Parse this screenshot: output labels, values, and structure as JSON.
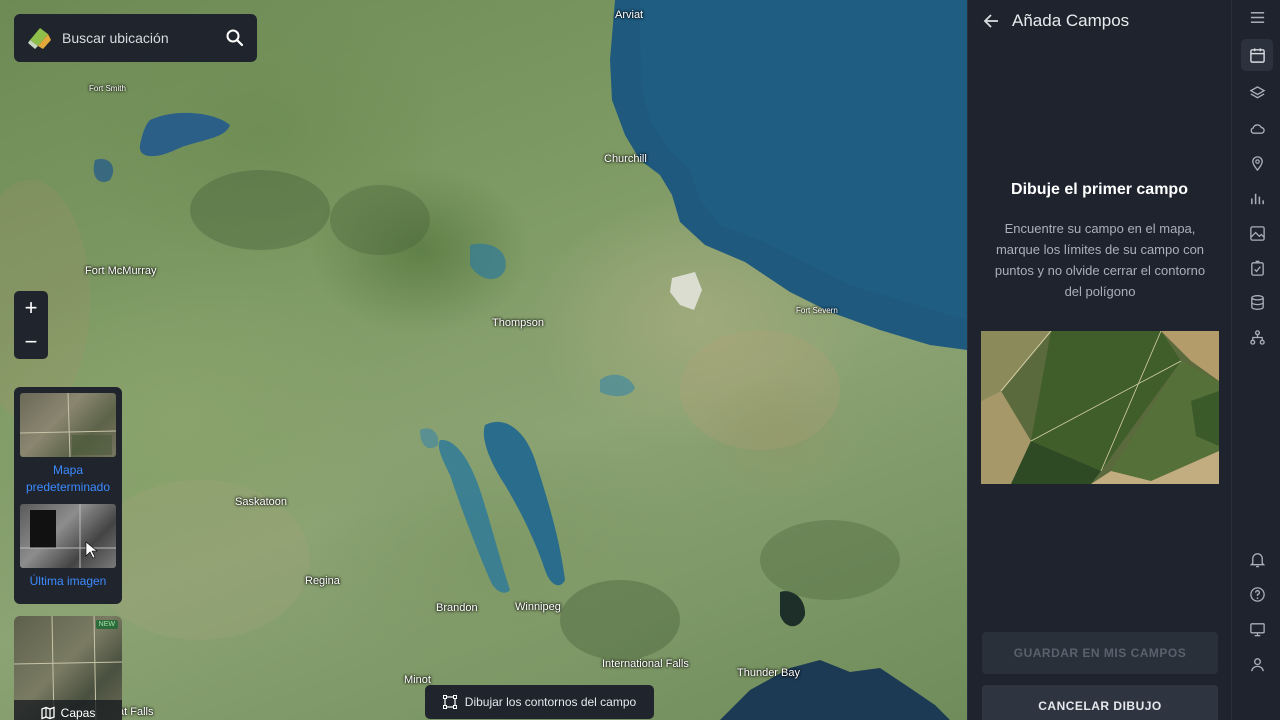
{
  "search": {
    "placeholder": "Buscar ubicación",
    "icon": "search-icon"
  },
  "map": {
    "cities": [
      {
        "name": "Arviat",
        "size": "normal"
      },
      {
        "name": "Fort Smith",
        "size": "small"
      },
      {
        "name": "Churchill",
        "size": "normal"
      },
      {
        "name": "Fort McMurray",
        "size": "normal"
      },
      {
        "name": "Thompson",
        "size": "normal"
      },
      {
        "name": "Fort Severn",
        "size": "small"
      },
      {
        "name": "Saskatoon",
        "size": "normal"
      },
      {
        "name": "Regina",
        "size": "normal"
      },
      {
        "name": "Brandon",
        "size": "normal"
      },
      {
        "name": "Winnipeg",
        "size": "normal"
      },
      {
        "name": "International Falls",
        "size": "normal"
      },
      {
        "name": "Thunder Bay",
        "size": "normal"
      },
      {
        "name": "Minot",
        "size": "normal"
      },
      {
        "name": "at Falls",
        "size": "normal"
      }
    ]
  },
  "zoom": {
    "in": "+",
    "out": "−"
  },
  "layers": {
    "default_label": "Mapa predeterminado",
    "latest_label": "Última imagen",
    "capas_label": "Capas",
    "new_badge": "NEW"
  },
  "draw_button": {
    "label": "Dibujar los contornos del campo"
  },
  "panel": {
    "title": "Añada Campos",
    "heading": "Dibuje el primer campo",
    "description": "Encuentre su campo en el mapa, marque los límites de su campo con puntos y no olvide cerrar el contorno del polígono",
    "save_label": "GUARDAR EN MIS CAMPOS",
    "cancel_label": "CANCELAR DIBUJO"
  },
  "rail": {
    "top_icons": [
      "menu-icon",
      "calendar-icon",
      "layers-icon",
      "cloud-icon",
      "location-pin-icon",
      "bar-chart-icon",
      "image-icon",
      "task-icon",
      "database-icon",
      "hierarchy-icon"
    ],
    "bottom_icons": [
      "bell-icon",
      "help-icon",
      "monitor-icon",
      "user-icon"
    ]
  },
  "colors": {
    "accent": "#3d8bff",
    "panel_bg": "#1e232d",
    "water": "#1f5a7e"
  }
}
